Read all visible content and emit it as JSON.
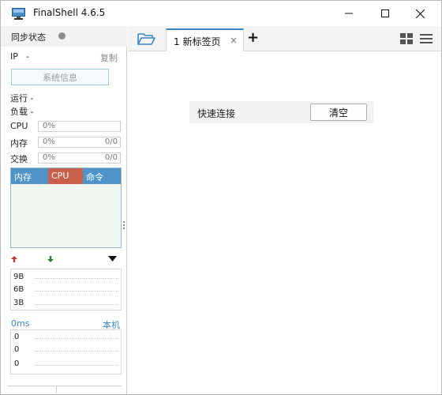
{
  "window": {
    "title": "FinalShell 4.6.5",
    "controls": {
      "minimize": "minimize-icon",
      "maximize": "maximize-icon",
      "close": "close-icon"
    }
  },
  "sidebar": {
    "sync_label": "同步状态",
    "ip_label": "IP",
    "ip_value": "-",
    "copy_label": "复制",
    "sysinfo_button": "系统信息",
    "uptime_label": "运行 -",
    "load_label": "负载 -",
    "cpu": {
      "label": "CPU",
      "value": "0%"
    },
    "memory": {
      "label": "内存",
      "value": "0%",
      "detail": "0/0"
    },
    "swap": {
      "label": "交换",
      "value": "0%",
      "detail": "0/0"
    },
    "process_table": {
      "columns": [
        "内存",
        "CPU",
        "命令"
      ]
    },
    "network": {
      "ticks": [
        "9B",
        "6B",
        "3B"
      ]
    },
    "ping": {
      "latency": "0ms",
      "host": "本机",
      "values": [
        "0",
        "0",
        "0"
      ]
    }
  },
  "tabs": {
    "items": [
      {
        "label": "1 新标签页",
        "close": "×"
      }
    ],
    "add": "+"
  },
  "quick_connect": {
    "label": "快速连接",
    "clear_button": "清空"
  },
  "colors": {
    "accent": "#3b86c6",
    "process_header": "#4f93c8",
    "cpu_header": "#c8604a",
    "upload_arrow": "#c0392b",
    "download_arrow": "#2e7d32"
  }
}
